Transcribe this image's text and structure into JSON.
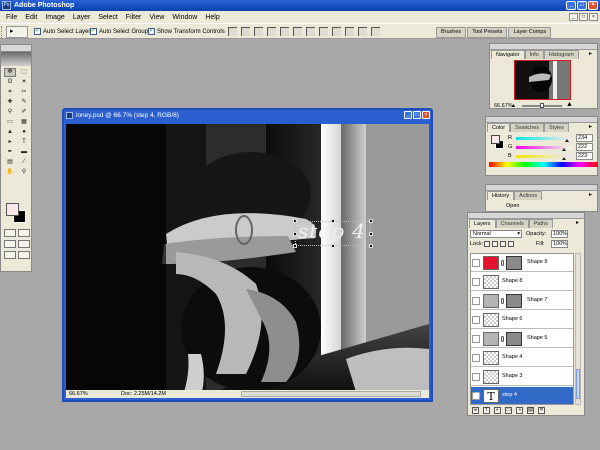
{
  "app": {
    "title": "Adobe Photoshop",
    "icon_label": "Ps",
    "window_buttons": [
      "_",
      "□",
      "×"
    ]
  },
  "menu": [
    "File",
    "Edit",
    "Image",
    "Layer",
    "Select",
    "Filter",
    "View",
    "Window",
    "Help"
  ],
  "options_bar": {
    "tool_preset_glyph": "▸",
    "auto_select_layer": {
      "label": "Auto Select Layer",
      "checked": true
    },
    "auto_select_groups": {
      "label": "Auto Select Groups",
      "checked": true
    },
    "show_transform_controls": {
      "label": "Show Transform Controls",
      "checked": true
    },
    "palette_well": [
      "Brushes",
      "Tool Presets",
      "Layer Comps"
    ]
  },
  "toolbox": {
    "tools": [
      "move-tool",
      "marquee-tool",
      "lasso-tool",
      "magic-wand-tool",
      "crop-tool",
      "slice-tool",
      "healing-brush-tool",
      "brush-tool",
      "clone-stamp-tool",
      "history-brush-tool",
      "eraser-tool",
      "gradient-tool",
      "blur-tool",
      "dodge-tool",
      "path-selection-tool",
      "type-tool",
      "pen-tool",
      "shape-tool",
      "notes-tool",
      "eyedropper-tool",
      "hand-tool",
      "zoom-tool"
    ],
    "tool_glyphs": [
      "✥",
      "⬚",
      "ʘ",
      "✶",
      "⌗",
      "✂",
      "✚",
      "✎",
      "⚲",
      "✐",
      "▭",
      "▦",
      "▲",
      "●",
      "▸",
      "T",
      "✒",
      "▬",
      "▤",
      "⁄",
      "✋",
      "⚲"
    ],
    "foreground_color": "#fbe8e8",
    "background_color": "#000000"
  },
  "document": {
    "title": "loney.psd @ 66.7% (step 4, RGB/8)",
    "canvas_text": "step 4",
    "zoom": "66.67%",
    "doc_size": "Doc: 2.25M/14.2M"
  },
  "navigator": {
    "tabs": [
      "Navigator",
      "Info",
      "Histogram"
    ],
    "zoom": "66.67%"
  },
  "color_panel": {
    "tabs": [
      "Color",
      "Swatches",
      "Styles"
    ],
    "channels": [
      {
        "label": "R",
        "value": "234",
        "gradient": "linear-gradient(90deg,#00e8e8,#ffe8e8)",
        "pos": 0.92
      },
      {
        "label": "G",
        "value": "222",
        "gradient": "linear-gradient(90deg,#f000e8,#f0ffe8)",
        "pos": 0.87
      },
      {
        "label": "B",
        "value": "223",
        "gradient": "linear-gradient(90deg,#f0e800,#f0e8ff)",
        "pos": 0.87
      }
    ]
  },
  "history_panel": {
    "tabs": [
      "History",
      "Actions"
    ],
    "items": [
      "Open"
    ]
  },
  "layers_panel": {
    "tabs": [
      "Layers",
      "Channels",
      "Paths"
    ],
    "blend_mode": "Normal",
    "opacity_label": "Opacity:",
    "opacity": "100%",
    "lock_label": "Lock:",
    "fill_label": "Fill:",
    "fill": "100%",
    "layers": [
      {
        "name": "Shape 9",
        "thumb": "red",
        "mask": true,
        "visible": false,
        "selected": false
      },
      {
        "name": "Shape 8",
        "thumb": "checker",
        "mask": false,
        "visible": false,
        "selected": false
      },
      {
        "name": "Shape 7",
        "thumb": "gray",
        "mask": true,
        "visible": false,
        "selected": false
      },
      {
        "name": "Shape 6",
        "thumb": "checker",
        "mask": false,
        "visible": false,
        "selected": false
      },
      {
        "name": "Shape 5",
        "thumb": "gray",
        "mask": true,
        "visible": false,
        "selected": false
      },
      {
        "name": "Shape 4",
        "thumb": "checker",
        "mask": false,
        "visible": false,
        "selected": false
      },
      {
        "name": "Shape 3",
        "thumb": "checker",
        "mask": false,
        "visible": false,
        "selected": false
      },
      {
        "name": "step 4",
        "thumb": "text",
        "mask": false,
        "visible": true,
        "selected": true
      }
    ]
  }
}
